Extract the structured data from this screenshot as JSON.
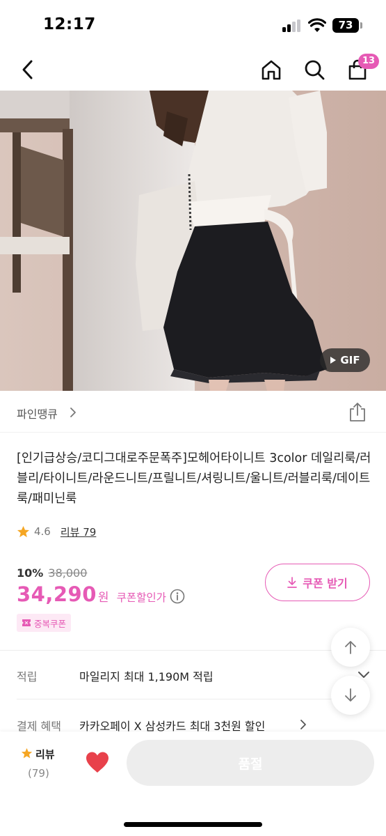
{
  "status_bar": {
    "time": "12:17",
    "battery": "73"
  },
  "nav": {
    "cart_badge": "13"
  },
  "hero": {
    "gif_label": "GIF"
  },
  "store": {
    "name": "파인땡큐"
  },
  "product": {
    "title": "[인기급상승/코디그대로주문폭주]모헤어타이니트 3color 데일리룩/러블리/타이니트/라운드니트/프릴니트/셔링니트/울니트/러블리룩/데이트룩/패미닌룩",
    "rating": "4.6",
    "review_link": "리뷰 79",
    "discount_rate": "10%",
    "original_price": "38,000",
    "sale_price": "34,290",
    "currency": "원",
    "coupon_discount_label": "쿠폰할인가",
    "coupon_button": "쿠폰 받기",
    "dup_coupon_badge": "중복쿠폰"
  },
  "info_rows": [
    {
      "label": "적립",
      "value": "마일리지 최대 1,190M 적립"
    },
    {
      "label": "결제 혜택",
      "value": "카카오페이 X 삼성카드 최대 3천원 할인"
    }
  ],
  "bottom_bar": {
    "review_label": "리뷰",
    "review_count": "(79)",
    "soldout_label": "품절"
  },
  "colors": {
    "accent": "#e65ab5",
    "star": "#f5a623",
    "heart": "#e8414b"
  }
}
